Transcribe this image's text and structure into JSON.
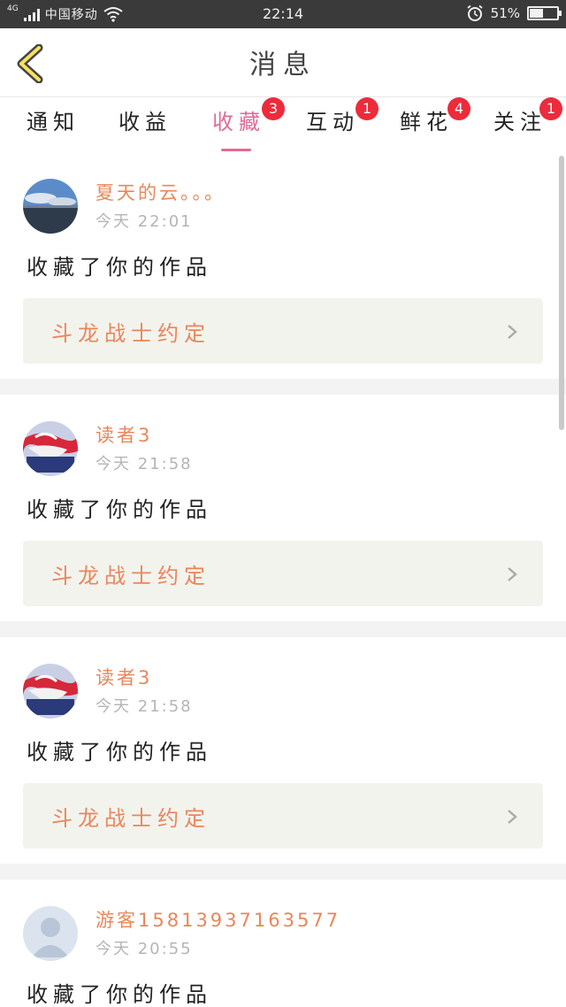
{
  "status_bar": {
    "network": "4G",
    "carrier": "中国移动",
    "time": "22:14",
    "battery": "51%",
    "battery_level": 0.51,
    "icons": [
      "signal-icon",
      "wifi-icon",
      "alarm-icon",
      "battery-icon"
    ]
  },
  "header": {
    "title": "消息",
    "back_icon": "chevron-left-icon"
  },
  "tabs": [
    {
      "label": "通知",
      "badge": ""
    },
    {
      "label": "收益",
      "badge": ""
    },
    {
      "label": "收藏",
      "badge": "3",
      "active": true
    },
    {
      "label": "互动",
      "badge": "1"
    },
    {
      "label": "鲜花",
      "badge": "4"
    },
    {
      "label": "关注",
      "badge": "1"
    }
  ],
  "colors": {
    "accent_pink": "#e26a94",
    "accent_orange": "#e8875a",
    "badge_red": "#ec2b3b"
  },
  "feed": [
    {
      "user": "夏天的云。。。",
      "time": "今天 22:01",
      "action": "收藏了你的作品",
      "work": "斗龙战士约定",
      "avatar": "sea-sky-avatar"
    },
    {
      "user": "读者3",
      "time": "今天 21:58",
      "action": "收藏了你的作品",
      "work": "斗龙战士约定",
      "avatar": "flag-avatar"
    },
    {
      "user": "读者3",
      "time": "今天 21:58",
      "action": "收藏了你的作品",
      "work": "斗龙战士约定",
      "avatar": "flag-avatar"
    },
    {
      "user": "游客15813937163577",
      "time": "今天 20:55",
      "action": "收藏了你的作品",
      "work": "",
      "avatar": "default-user-avatar"
    }
  ]
}
